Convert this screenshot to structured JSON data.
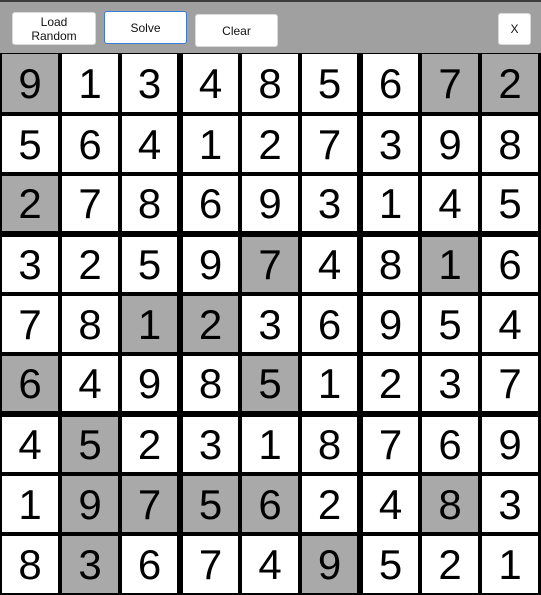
{
  "toolbar": {
    "load_random_label": "Load Random",
    "solve_label": "Solve",
    "clear_label": "Clear",
    "close_label": "X"
  },
  "colors": {
    "toolbar_bg": "#a0a0a0",
    "given_cell_bg": "#a9a9a9",
    "cell_bg": "#ffffff",
    "grid_line": "#000000",
    "focus_border": "#3a7bd5"
  },
  "board": {
    "values": [
      [
        9,
        1,
        3,
        4,
        8,
        5,
        6,
        7,
        2
      ],
      [
        5,
        6,
        4,
        1,
        2,
        7,
        3,
        9,
        8
      ],
      [
        2,
        7,
        8,
        6,
        9,
        3,
        1,
        4,
        5
      ],
      [
        3,
        2,
        5,
        9,
        7,
        4,
        8,
        1,
        6
      ],
      [
        7,
        8,
        1,
        2,
        3,
        6,
        9,
        5,
        4
      ],
      [
        6,
        4,
        9,
        8,
        5,
        1,
        2,
        3,
        7
      ],
      [
        4,
        5,
        2,
        3,
        1,
        8,
        7,
        6,
        9
      ],
      [
        1,
        9,
        7,
        5,
        6,
        2,
        4,
        8,
        3
      ],
      [
        8,
        3,
        6,
        7,
        4,
        9,
        5,
        2,
        1
      ]
    ],
    "given": [
      [
        1,
        0,
        0,
        0,
        0,
        0,
        0,
        1,
        1
      ],
      [
        0,
        0,
        0,
        0,
        0,
        0,
        0,
        0,
        0
      ],
      [
        1,
        0,
        0,
        0,
        0,
        0,
        0,
        0,
        0
      ],
      [
        0,
        0,
        0,
        0,
        1,
        0,
        0,
        1,
        0
      ],
      [
        0,
        0,
        1,
        1,
        0,
        0,
        0,
        0,
        0
      ],
      [
        1,
        0,
        0,
        0,
        1,
        0,
        0,
        0,
        0
      ],
      [
        0,
        1,
        0,
        0,
        0,
        0,
        0,
        0,
        0
      ],
      [
        0,
        1,
        1,
        1,
        1,
        0,
        0,
        1,
        0
      ],
      [
        0,
        1,
        0,
        0,
        0,
        1,
        0,
        0,
        0
      ]
    ]
  }
}
